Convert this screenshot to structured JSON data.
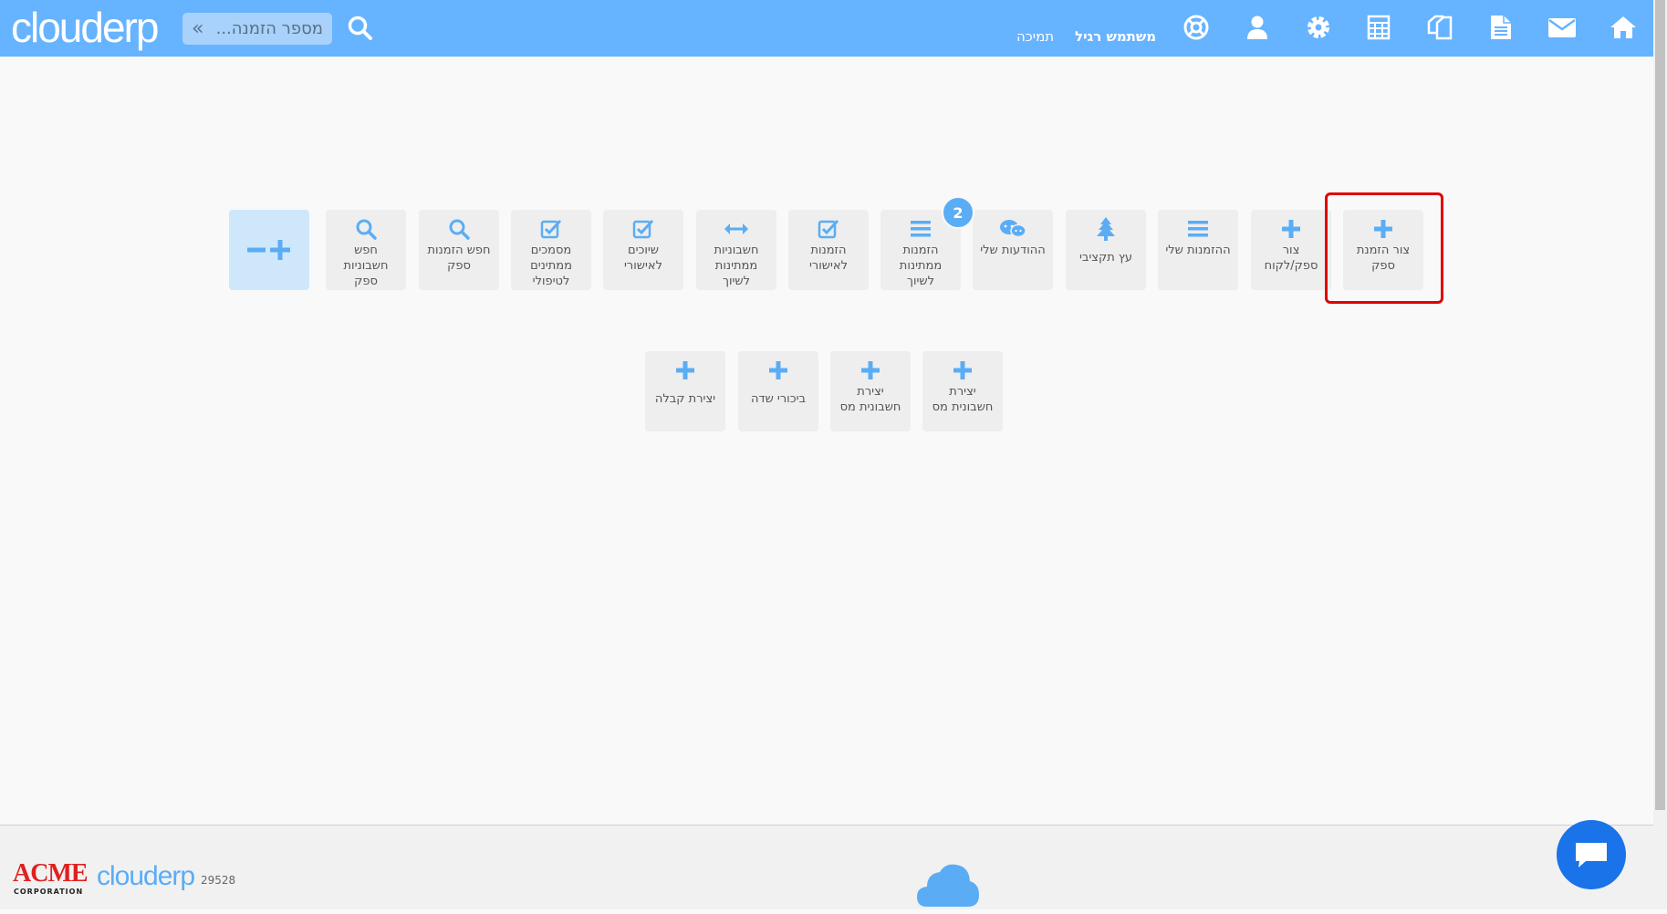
{
  "header": {
    "logo_text": "clouderp",
    "search_placeholder": "מספר הזמנה...",
    "support_link": "תמיכה",
    "user_name": "משתמש רגיל"
  },
  "header_icons": [
    "help-lifebuoy-icon",
    "user-icon",
    "gear-icon",
    "calculator-icon",
    "documents-icon",
    "document-icon",
    "envelope-icon",
    "home-icon"
  ],
  "tiles_row1": [
    {
      "label": "צור הזמנת ספק",
      "icon": "plus-icon",
      "highlighted": true
    },
    {
      "label": "צור ספק/לקוח",
      "icon": "plus-icon"
    },
    {
      "label": "ההזמנות שלי",
      "icon": "list-icon"
    },
    {
      "label": "עץ תקציבי",
      "icon": "tree-icon"
    },
    {
      "label": "ההודעות שלי",
      "icon": "chat-icon"
    },
    {
      "label": "הזמנות ממתינות לשיוך",
      "icon": "list-icon",
      "badge": "2"
    },
    {
      "label": "הזמנות לאישורי",
      "icon": "checkbox-icon"
    },
    {
      "label": "חשבוניות ממתינות לשיוך",
      "icon": "arrows-horizontal-icon"
    },
    {
      "label": "שיוכים לאישורי",
      "icon": "checkbox-icon"
    },
    {
      "label": "מסמכים ממתינים לטיפולי",
      "icon": "checkbox-icon"
    },
    {
      "label": "חפש הזמנות ספק",
      "icon": "search-icon"
    },
    {
      "label": "חפש חשבוניות ספק",
      "icon": "search-icon"
    }
  ],
  "tiles_row2": [
    {
      "label": "יצירת חשבונית מס",
      "icon": "plus-icon"
    },
    {
      "label": "יצירת חשבונית מס",
      "icon": "plus-icon"
    },
    {
      "label": "ביכורי שדה",
      "icon": "plus-icon"
    },
    {
      "label": "יצירת קבלה",
      "icon": "plus-icon"
    }
  ],
  "footer": {
    "client_logo": "ACME",
    "client_logo_sub": "CORPORATION",
    "brand_logo": "clouderp",
    "number": "29528"
  },
  "colors": {
    "header_bg": "#66b3ff",
    "accent": "#5aadf5",
    "tile_bg": "#eeeeee",
    "highlight": "#e00000",
    "chat_button": "#1a73e8"
  }
}
